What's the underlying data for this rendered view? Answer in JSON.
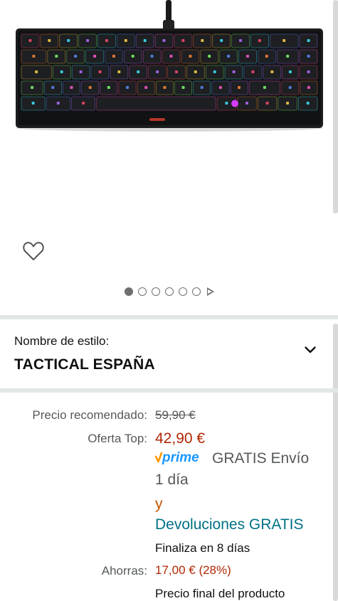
{
  "gallery": {
    "image_alt": "Teclado mecánico RGB negro",
    "dots_total": 6,
    "active_dot": 1,
    "icons": {
      "wishlist": "heart-outline-icon",
      "video": "play-triangle-icon"
    }
  },
  "style_selector": {
    "label": "Nombre de estilo:",
    "value": "TACTICAL ESPAÑA",
    "icon": "chevron-down-icon"
  },
  "price": {
    "rrp_label": "Precio recomendado:",
    "rrp_value": "59,90 €",
    "offer_label": "Oferta Top:",
    "offer_value": "42,90 €",
    "prime_logo_text": "prime",
    "prime_shipping": "GRATIS Envío",
    "prime_day": "1 día",
    "and": "y",
    "returns": "Devoluciones GRATIS",
    "ends_in": "Finaliza en 8 días",
    "save_label": "Ahorras:",
    "save_value": "17,00 € (28%)",
    "final_price_note": "Precio final del producto"
  },
  "colors": {
    "price_red": "#b12704",
    "link_teal": "#007185",
    "prime_blue": "#1a98ff",
    "prime_check": "#ff9900",
    "muted": "#565959",
    "separator": "#e3e6e6"
  }
}
